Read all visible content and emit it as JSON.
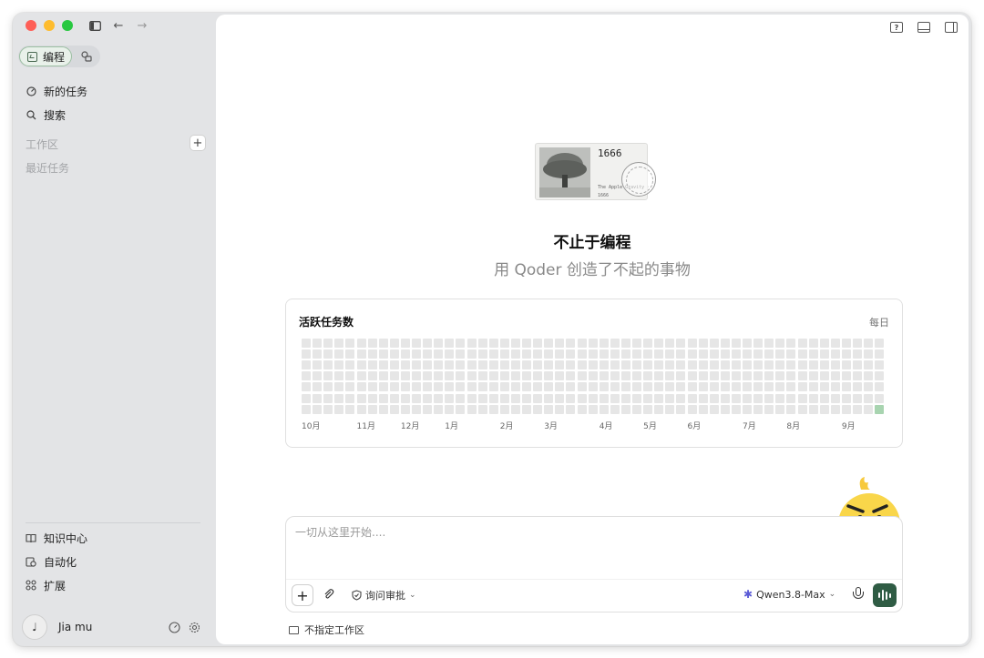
{
  "sidebar": {
    "modes": {
      "active_label": "编程"
    },
    "nav": [
      {
        "label": "新的任务",
        "icon": "new-task-icon"
      },
      {
        "label": "搜索",
        "icon": "search-icon"
      }
    ],
    "section_workspace": "工作区",
    "section_recent": "最近任务",
    "bottom_nav": [
      {
        "label": "知识中心",
        "icon": "book-icon"
      },
      {
        "label": "自动化",
        "icon": "calendar-clock-icon"
      },
      {
        "label": "扩展",
        "icon": "extensions-icon"
      }
    ],
    "user": {
      "name": "Jia mu",
      "avatar_glyph": "♩"
    }
  },
  "hero": {
    "card_number": "1666",
    "card_caption": "The Apple Gravity · 1666",
    "title": "不止于编程",
    "subtitle": "用 Qoder 创造了不起的事物"
  },
  "activity": {
    "title": "活跃任务数",
    "period": "每日",
    "months": [
      "10月",
      "11月",
      "12月",
      "1月",
      "2月",
      "3月",
      "4月",
      "5月",
      "6月",
      "7月",
      "8月",
      "9月"
    ],
    "active_day_count": 1,
    "colors": {
      "empty": "#e6e6e6",
      "active": "#a8d4b0"
    }
  },
  "composer": {
    "placeholder": "一切从这里开始....",
    "approval_label": "询问审批",
    "model_label": "Qwen3.8-Max"
  },
  "workspace_picker": {
    "label": "不指定工作区"
  },
  "colors": {
    "accent": "#2f5c44",
    "sidebar_bg": "#e3e4e6"
  }
}
